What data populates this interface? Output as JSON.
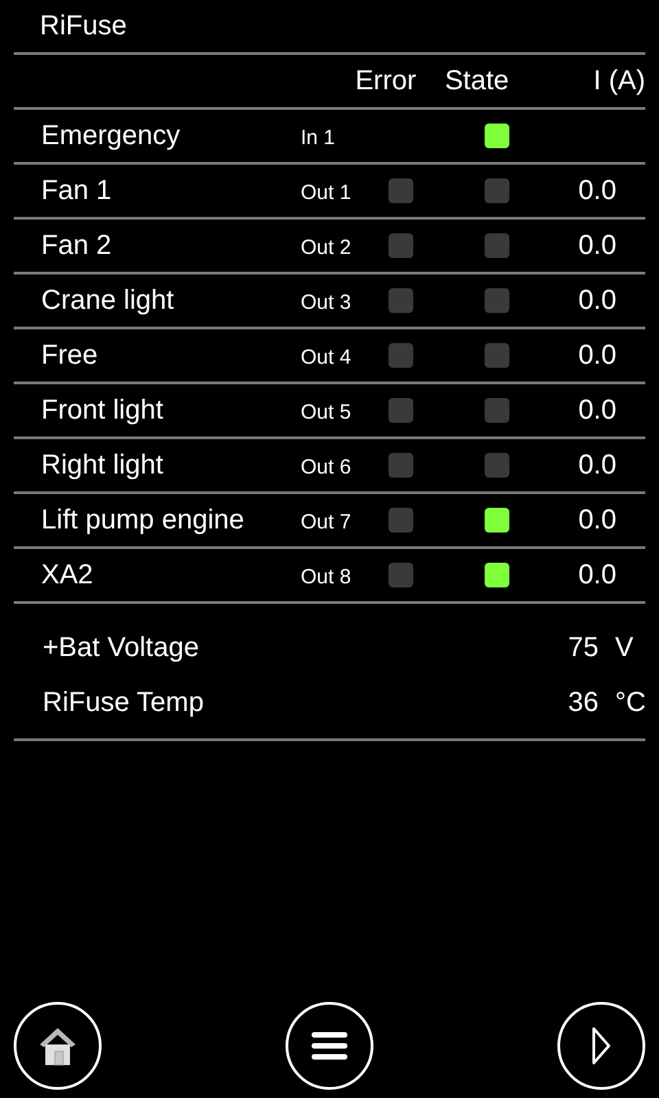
{
  "title": "RiFuse",
  "columns": [
    "Error",
    "State",
    "I (A)"
  ],
  "channels": [
    {
      "name": "Emergency",
      "port": "In 1",
      "state": true
    },
    {
      "name": "Fan 1",
      "port": "Out 1",
      "error": false,
      "state": false,
      "current": "0.0"
    },
    {
      "name": "Fan 2",
      "port": "Out 2",
      "error": false,
      "state": false,
      "current": "0.0"
    },
    {
      "name": "Crane light",
      "port": "Out 3",
      "error": false,
      "state": false,
      "current": "0.0"
    },
    {
      "name": "Free",
      "port": "Out 4",
      "error": false,
      "state": false,
      "current": "0.0"
    },
    {
      "name": "Front light",
      "port": "Out 5",
      "error": false,
      "state": false,
      "current": "0.0"
    },
    {
      "name": "Right light",
      "port": "Out 6",
      "error": false,
      "state": false,
      "current": "0.0"
    },
    {
      "name": "Lift pump engine",
      "port": "Out 7",
      "error": false,
      "state": true,
      "current": "0.0"
    },
    {
      "name": "XA2",
      "port": "Out 8",
      "error": false,
      "state": true,
      "current": "0.0"
    }
  ],
  "readings": [
    {
      "label": "+Bat Voltage",
      "value": "75",
      "unit": "V"
    },
    {
      "label": "RiFuse Temp",
      "value": "36",
      "unit": "°C"
    }
  ],
  "buttons": [
    {
      "kind": "home"
    },
    {
      "kind": "menu"
    },
    {
      "kind": "next"
    }
  ]
}
